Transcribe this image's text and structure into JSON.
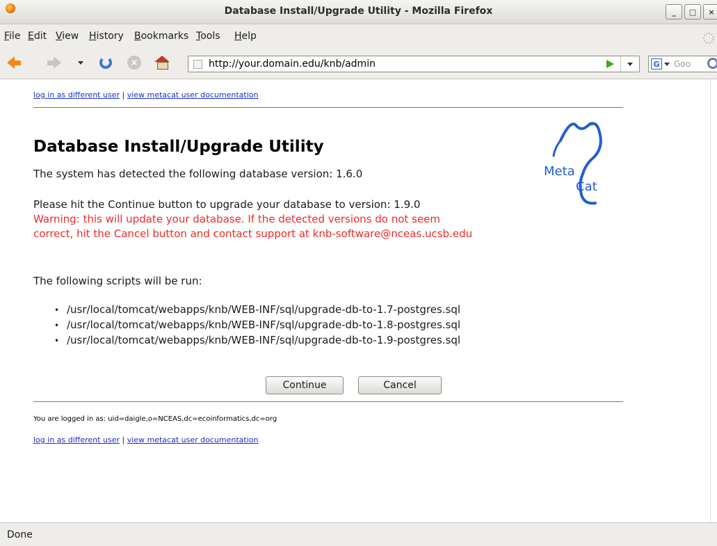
{
  "window": {
    "title": "Database Install/Upgrade Utility - Mozilla Firefox",
    "buttons": {
      "minimize": "_",
      "maximize": "□",
      "close": "×"
    }
  },
  "menu": [
    "File",
    "Edit",
    "View",
    "History",
    "Bookmarks",
    "Tools",
    "Help"
  ],
  "navigation": {
    "url": "http://your.domain.edu/knb/admin",
    "search_engine_icon": "G",
    "search_placeholder": "Goo"
  },
  "page": {
    "top_links": {
      "login": "log in as different user",
      "separator": "|",
      "docs": "view metacat user documentation"
    },
    "title": "Database Install/Upgrade Utility",
    "detected_line": "The system has detected the following database version: 1.6.0",
    "upgrade_line": "Please hit the Continue button to upgrade your database to version: 1.9.0",
    "warning_line1": "Warning: this will update your database. If the detected versions do not seem",
    "warning_line2": "correct, hit the Cancel button and contact support at knb-software@nceas.ucsb.edu",
    "scripts_heading": "The following scripts will be run:",
    "scripts": [
      "/usr/local/tomcat/webapps/knb/WEB-INF/sql/upgrade-db-to-1.7-postgres.sql",
      "/usr/local/tomcat/webapps/knb/WEB-INF/sql/upgrade-db-to-1.8-postgres.sql",
      "/usr/local/tomcat/webapps/knb/WEB-INF/sql/upgrade-db-to-1.9-postgres.sql"
    ],
    "continue_label": "Continue",
    "cancel_label": "Cancel",
    "logged_in": "You are logged in as: uid=daigle,o=NCEAS,dc=ecoinformatics,dc=org",
    "bottom_links": {
      "login": "log in as different user",
      "separator": "|",
      "docs": "view metacat user documentation"
    },
    "logo": {
      "meta": "Meta",
      "cat": "Cat",
      "color": "#1f5fd1"
    },
    "warning_color": "#ee2a2a"
  },
  "status": "Done"
}
